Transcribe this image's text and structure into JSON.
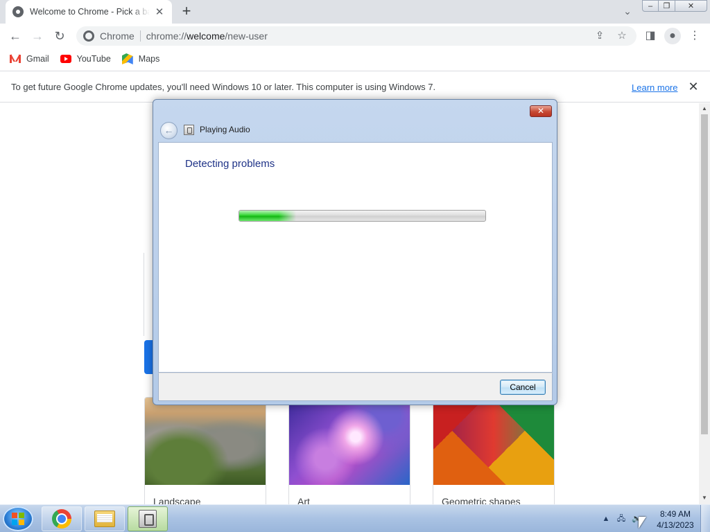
{
  "browser": {
    "tab": {
      "title": "Welcome to Chrome - Pick a background"
    },
    "new_tab_symbol": "+",
    "address": {
      "chip": "Chrome",
      "url_prefix": "chrome://",
      "url_host": "welcome",
      "url_path": "/new-user"
    },
    "bookmarks": [
      {
        "label": "Gmail",
        "icon": "gmail-icon"
      },
      {
        "label": "YouTube",
        "icon": "youtube-icon"
      },
      {
        "label": "Maps",
        "icon": "maps-icon"
      }
    ],
    "infobar": {
      "message": "To get future Google Chrome updates, you'll need Windows 10 or later. This computer is using Windows 7.",
      "link": "Learn more"
    }
  },
  "page": {
    "backgrounds": [
      {
        "label": "Landscape"
      },
      {
        "label": "Art"
      },
      {
        "label": "Geometric shapes"
      }
    ]
  },
  "dialog": {
    "title": "Playing Audio",
    "heading": "Detecting problems",
    "progress": 0.23,
    "cancel_label": "Cancel"
  },
  "taskbar": {
    "items": [
      "chrome",
      "file-explorer",
      "troubleshooter"
    ],
    "active_item": "troubleshooter",
    "time": "8:49 AM",
    "date": "4/13/2023"
  },
  "colors": {
    "accent": "#1a73e8",
    "dialog_heading": "#1e3287",
    "progress_green": "#37d637"
  }
}
